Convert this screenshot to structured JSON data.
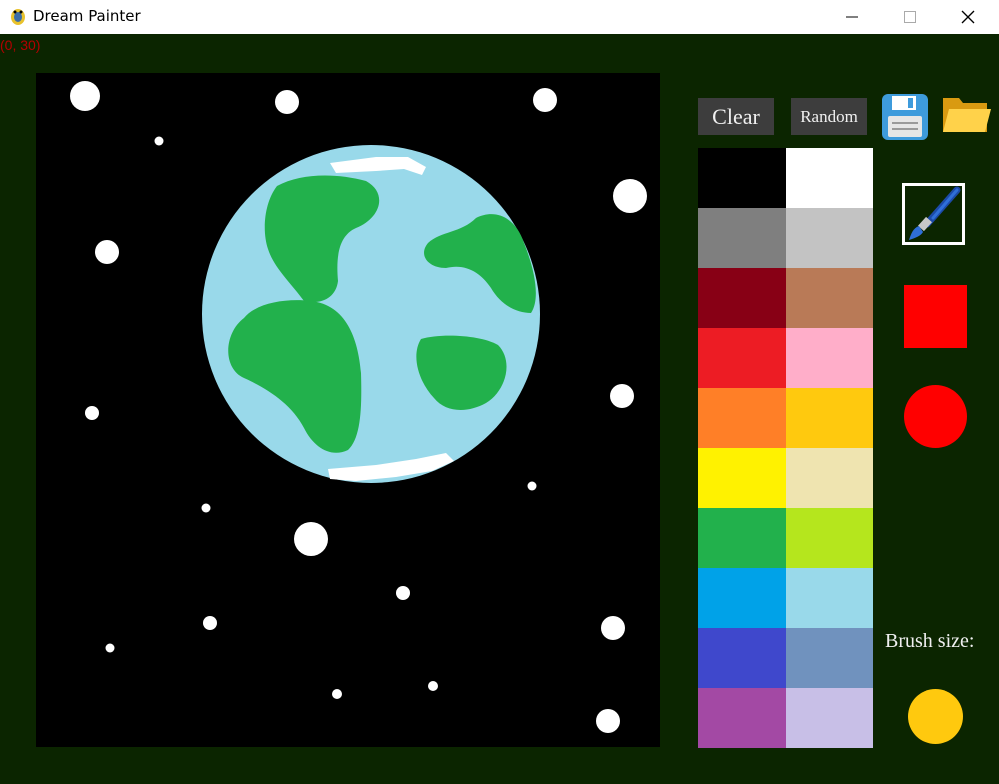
{
  "window": {
    "title": "Dream Painter",
    "minimize_glyph": "—",
    "maximize_glyph": "☐",
    "close_glyph": "✕"
  },
  "status": {
    "cursor_position": "(0, 30)"
  },
  "toolbar": {
    "clear_label": "Clear",
    "random_label": "Random",
    "save_icon": "floppy-disk-icon",
    "open_icon": "folder-icon"
  },
  "palette": {
    "colors": [
      "#000000",
      "#ffffff",
      "#7f7f7f",
      "#c3c3c3",
      "#880015",
      "#b97a57",
      "#ed1c24",
      "#ffaec9",
      "#ff7f27",
      "#ffc90e",
      "#fff200",
      "#efe4b0",
      "#22b14c",
      "#b5e61d",
      "#00a2e8",
      "#99d9ea",
      "#3f48cc",
      "#7092be",
      "#a349a4",
      "#c8bfe7"
    ]
  },
  "tools": {
    "brush_icon": "paintbrush-icon",
    "rect_icon": "square-shape-icon",
    "circle_icon": "circle-shape-icon",
    "current_color": "#ff0000"
  },
  "brush": {
    "label": "Brush size:",
    "preview_color": "#ffc90e"
  },
  "colors": {
    "background": "#0b2500",
    "canvas": "#000000",
    "button": "#3d3d3d"
  }
}
